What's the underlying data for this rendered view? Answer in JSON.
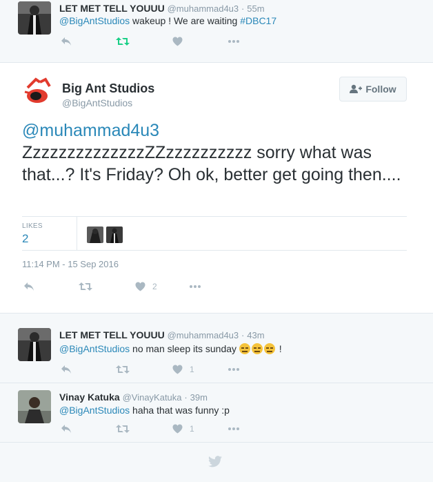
{
  "tweets_above": [
    {
      "name": "LET MET TELL YOUUU",
      "handle": "@muhammad4u3",
      "dot": "·",
      "time": "55m",
      "mention": "@BigAntStudios",
      "text": " wakeup ! We are waiting ",
      "hashtag": "#DBC17"
    }
  ],
  "main_tweet": {
    "name": "Big Ant Studios",
    "handle": "@BigAntStudios",
    "follow_label": "Follow",
    "mention": "@muhammad4u3",
    "text": "ZzzzzzzzzzzzzzZZzzzzzzzzzz sorry what was that...? It's Friday? Oh ok, better get going then....",
    "likes_label": "LIKES",
    "likes_count": "2",
    "timestamp": "11:14 PM - 15 Sep 2016",
    "like_action_count": "2"
  },
  "replies": [
    {
      "name": "LET MET TELL YOUUU",
      "handle": "@muhammad4u3",
      "dot": "·",
      "time": "43m",
      "mention": "@BigAntStudios",
      "text": " no man sleep its sunday ",
      "text_end": " !",
      "like_count": "1"
    },
    {
      "name": "Vinay Katuka",
      "handle": "@VinayKatuka",
      "dot": "·",
      "time": "39m",
      "mention": "@BigAntStudios",
      "text": " haha that was funny :p",
      "like_count": "1"
    }
  ],
  "icons": [
    "reply-icon",
    "retweet-icon",
    "like-icon",
    "more-icon",
    "follow-icon",
    "twitter-bird-icon"
  ],
  "colors": {
    "link": "#2a88b8",
    "retweeted": "#19cf86",
    "muted": "#aab8c2",
    "background": "#f5f8fa"
  }
}
